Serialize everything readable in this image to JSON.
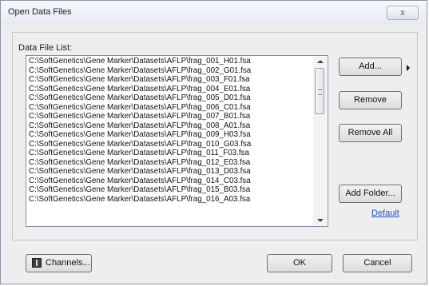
{
  "window": {
    "title": "Open Data Files",
    "close_label": "x"
  },
  "group": {
    "label": "Data File List:"
  },
  "files": [
    "C:\\SoftGenetics\\Gene Marker\\Datasets\\AFLP\\frag_001_H01.fsa",
    "C:\\SoftGenetics\\Gene Marker\\Datasets\\AFLP\\frag_002_G01.fsa",
    "C:\\SoftGenetics\\Gene Marker\\Datasets\\AFLP\\frag_003_F01.fsa",
    "C:\\SoftGenetics\\Gene Marker\\Datasets\\AFLP\\frag_004_E01.fsa",
    "C:\\SoftGenetics\\Gene Marker\\Datasets\\AFLP\\frag_005_D01.fsa",
    "C:\\SoftGenetics\\Gene Marker\\Datasets\\AFLP\\frag_006_C01.fsa",
    "C:\\SoftGenetics\\Gene Marker\\Datasets\\AFLP\\frag_007_B01.fsa",
    "C:\\SoftGenetics\\Gene Marker\\Datasets\\AFLP\\frag_008_A01.fsa",
    "C:\\SoftGenetics\\Gene Marker\\Datasets\\AFLP\\frag_009_H03.fsa",
    "C:\\SoftGenetics\\Gene Marker\\Datasets\\AFLP\\frag_010_G03.fsa",
    "C:\\SoftGenetics\\Gene Marker\\Datasets\\AFLP\\frag_011_F03.fsa",
    "C:\\SoftGenetics\\Gene Marker\\Datasets\\AFLP\\frag_012_E03.fsa",
    "C:\\SoftGenetics\\Gene Marker\\Datasets\\AFLP\\frag_013_D03.fsa",
    "C:\\SoftGenetics\\Gene Marker\\Datasets\\AFLP\\frag_014_C03.fsa",
    "C:\\SoftGenetics\\Gene Marker\\Datasets\\AFLP\\frag_015_B03.fsa",
    "C:\\SoftGenetics\\Gene Marker\\Datasets\\AFLP\\frag_016_A03.fsa"
  ],
  "buttons": {
    "add": "Add...",
    "remove": "Remove",
    "remove_all": "Remove All",
    "add_folder": "Add Folder...",
    "default_link": "Default",
    "channels": "Channels...",
    "ok": "OK",
    "cancel": "Cancel"
  },
  "icons": {
    "close": "close-icon",
    "add_menu": "triangle-right-icon",
    "channels": "channels-icon",
    "scroll_up": "arrow-up-icon",
    "scroll_down": "arrow-down-icon"
  }
}
